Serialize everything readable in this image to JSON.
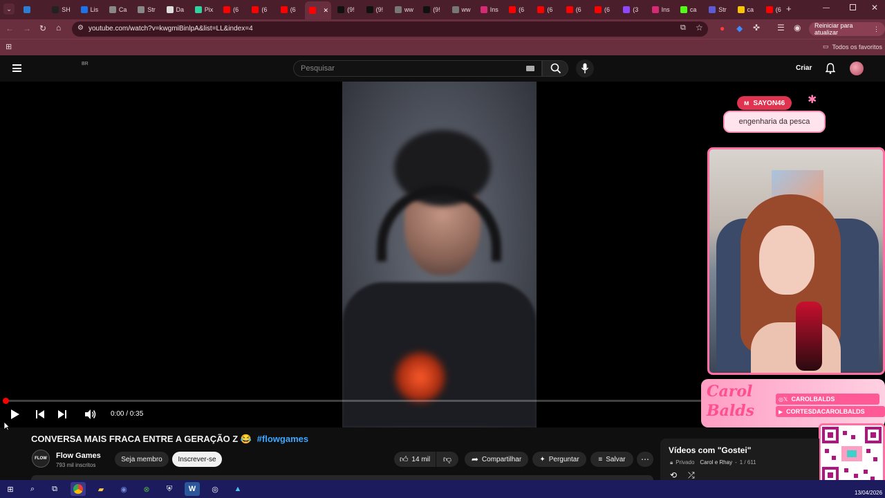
{
  "browser": {
    "tabs": [
      {
        "label": "",
        "color": "#2a7fd4"
      },
      {
        "label": "SH",
        "color": "#222"
      },
      {
        "label": "Lis",
        "color": "#1a73e8"
      },
      {
        "label": "Ca",
        "color": "#888"
      },
      {
        "label": "Str",
        "color": "#888"
      },
      {
        "label": "Da",
        "color": "#ddd"
      },
      {
        "label": "Pix",
        "color": "#2fd3a0"
      },
      {
        "label": "(6",
        "color": "#ff0000"
      },
      {
        "label": "(6",
        "color": "#ff0000"
      },
      {
        "label": "(6",
        "color": "#ff0000"
      },
      {
        "label": "",
        "color": "#ff0000"
      },
      {
        "label": "(9!",
        "color": "#111"
      },
      {
        "label": "(9!",
        "color": "#111"
      },
      {
        "label": "ww",
        "color": "#777"
      },
      {
        "label": "(9!",
        "color": "#111"
      },
      {
        "label": "ww",
        "color": "#777"
      },
      {
        "label": "Ins",
        "color": "#d62976"
      },
      {
        "label": "(6",
        "color": "#ff0000"
      },
      {
        "label": "(6",
        "color": "#ff0000"
      },
      {
        "label": "(6",
        "color": "#ff0000"
      },
      {
        "label": "(6",
        "color": "#ff0000"
      },
      {
        "label": "(3",
        "color": "#9146ff"
      },
      {
        "label": "Ins",
        "color": "#d62976"
      },
      {
        "label": "ca",
        "color": "#53fc18"
      },
      {
        "label": "Str",
        "color": "#5b5bd6"
      },
      {
        "label": "ca",
        "color": "#f7c600"
      },
      {
        "label": "(6",
        "color": "#ff0000"
      }
    ],
    "url": "youtube.com/watch?v=kwgmiBinlpA&list=LL&index=4",
    "restart_label": "Reiniciar para atualizar",
    "bookmarks_label": "Todos os favoritos"
  },
  "youtube": {
    "region": "BR",
    "search_placeholder": "Pesquisar",
    "create_label": "Criar",
    "time": "0:00 / 0:35",
    "progress_fraction": 0.002,
    "video_title": "CONVERSA MAIS FRACA ENTRE A GERAÇÃO Z 😂",
    "hashtag": "#flowgames",
    "channel_name": "Flow Games",
    "subscribers": "793 mil inscritos",
    "member_label": "Seja membro",
    "subscribe_label": "Inscrever-se",
    "likes": "14 mil",
    "share_label": "Compartilhar",
    "ask_label": "Perguntar",
    "save_label": "Salvar",
    "playlist_title": "Vídeos com \"Gostei\"",
    "playlist_privacy": "Privado",
    "playlist_meta": "Carol e Rhay",
    "playlist_position": "1 / 611"
  },
  "overlay": {
    "sponsor_tag": "SAYON46",
    "sponsor_text": "engenharia da pesca",
    "streamer_logo": "Carol Balds",
    "social_handle_1": "CAROLBALDS",
    "social_handle_2": "CORTESDACAROLBALDS"
  },
  "taskbar": {
    "date": "13/04/2026"
  },
  "colors": {
    "tab_strip": "#4a1f2b",
    "toolbar": "#6a2f3e",
    "accent_pink": "#ff6fa3",
    "youtube_red": "#ff0000",
    "taskbar": "#1b1b5e"
  }
}
